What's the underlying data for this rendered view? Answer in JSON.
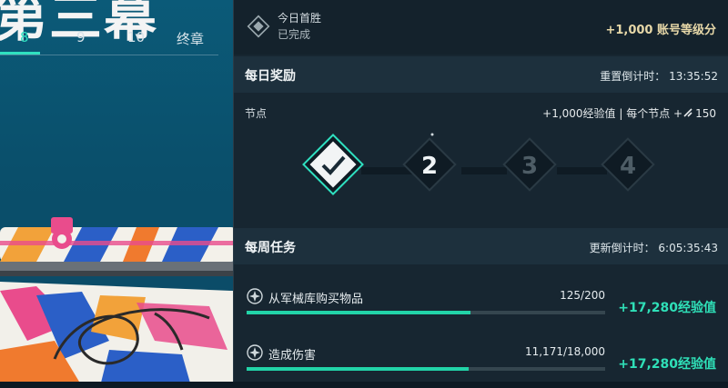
{
  "left": {
    "act_title": "第三幕",
    "chapter_tabs": [
      {
        "label": "8",
        "active": true
      },
      {
        "label": "9",
        "active": false
      },
      {
        "label": "10",
        "active": false
      },
      {
        "label": "终章",
        "active": false
      }
    ]
  },
  "first_win": {
    "name": "今日首胜",
    "status": "已完成",
    "reward": "+1,000 账号等级分"
  },
  "daily": {
    "title": "每日奖励",
    "timer": "重置倒计时： 13:35:52",
    "nodes_label": "节点",
    "nodes_reward": "+1,000经验值 | 每个节点 +",
    "nodes_reward_amount": "150",
    "nodes": [
      {
        "label": "",
        "completed": true
      },
      {
        "label": "2",
        "completed": false
      },
      {
        "label": "3",
        "completed": false
      },
      {
        "label": "4",
        "completed": false
      }
    ]
  },
  "weekly": {
    "title": "每周任务",
    "timer": "更新倒计时： 6:05:35:43",
    "missions": [
      {
        "name": "从军械库购买物品",
        "progress": "125/200",
        "fraction": 0.625,
        "xp": "+17,280经验值"
      },
      {
        "name": "造成伤害",
        "progress": "11,171/18,000",
        "fraction": 0.62,
        "xp": "+17,280经验值"
      }
    ]
  },
  "colors": {
    "accent": "#2fe0c0",
    "xp": "#2fe0b8",
    "reward_gold": "#e7d8a8"
  }
}
